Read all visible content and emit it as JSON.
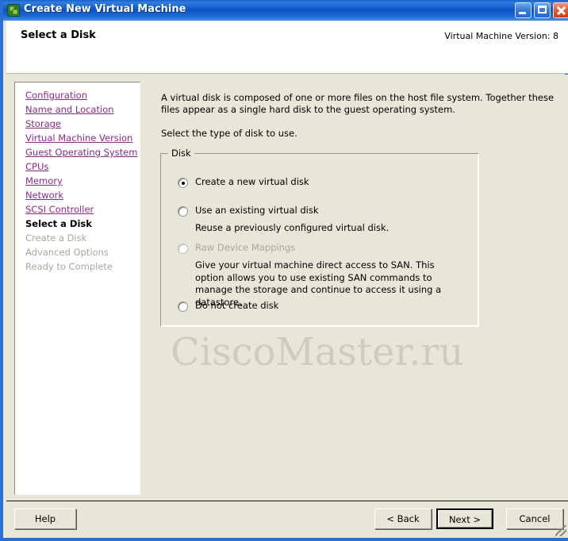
{
  "window": {
    "title": "Create New Virtual Machine",
    "icon": "vm-icon",
    "controls": {
      "minimize": "minimize-button",
      "maximize": "maximize-button",
      "close": "close-button"
    }
  },
  "header": {
    "page_title": "Select a Disk",
    "version_label": "Virtual Machine Version: 8"
  },
  "sidebar": {
    "items": [
      {
        "label": "Configuration",
        "state": "link"
      },
      {
        "label": "Name and Location",
        "state": "link"
      },
      {
        "label": "Storage",
        "state": "link"
      },
      {
        "label": "Virtual Machine Version",
        "state": "link"
      },
      {
        "label": "Guest Operating System",
        "state": "link"
      },
      {
        "label": "CPUs",
        "state": "link"
      },
      {
        "label": "Memory",
        "state": "link"
      },
      {
        "label": "Network",
        "state": "link"
      },
      {
        "label": "SCSI Controller",
        "state": "link"
      },
      {
        "label": "Select a Disk",
        "state": "current"
      },
      {
        "label": "Create a Disk",
        "state": "disabled"
      },
      {
        "label": "Advanced Options",
        "state": "disabled"
      },
      {
        "label": "Ready to Complete",
        "state": "disabled"
      }
    ]
  },
  "content": {
    "intro": "A virtual disk is composed of one or more files on the host file system. Together these files appear as a single hard disk to the guest operating system.",
    "instruction": "Select the type of disk to use.",
    "group_legend": "Disk",
    "options": [
      {
        "label": "Create a new virtual disk",
        "selected": true,
        "enabled": true,
        "description": ""
      },
      {
        "label": "Use an existing virtual disk",
        "selected": false,
        "enabled": true,
        "description": "Reuse a previously configured virtual disk."
      },
      {
        "label": "Raw Device Mappings",
        "selected": false,
        "enabled": false,
        "description": "Give your virtual machine direct access to SAN. This option allows you to use existing SAN commands to manage the storage and continue to access it using a datastore."
      },
      {
        "label": "Do not create disk",
        "selected": false,
        "enabled": true,
        "description": ""
      }
    ]
  },
  "watermark": {
    "text": "CiscoMaster.ru"
  },
  "footer": {
    "help_label": "Help",
    "back_label": "< Back",
    "next_label": "Next >",
    "cancel_label": "Cancel"
  },
  "colors": {
    "titlebar": "#0b53c6",
    "window_background": "#e8e6d9",
    "link": "#8a2a8a",
    "disabled_text": "#a9a79a",
    "watermark": "#cfcbba"
  }
}
